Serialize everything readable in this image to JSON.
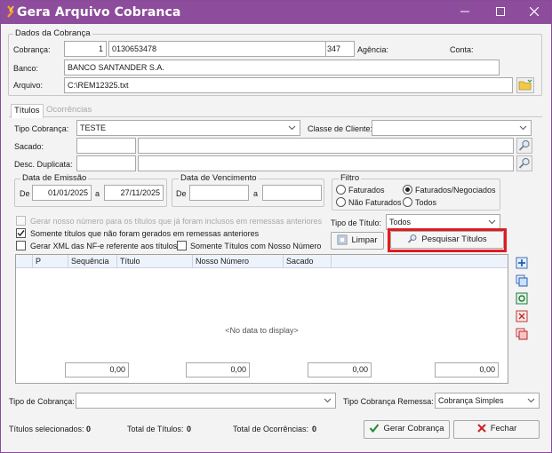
{
  "window": {
    "title": "Gera Arquivo Cobranca"
  },
  "dados": {
    "group_title": "Dados da Cobrança",
    "cobranca_label": "Cobrança:",
    "cobranca_num": "1",
    "cobranca_desc": "0130653478",
    "cobranca_code": "347",
    "agencia_label": "Agência:",
    "conta_label": "Conta:",
    "banco_label": "Banco:",
    "banco_value": "BANCO SANTANDER S.A.",
    "arquivo_label": "Arquivo:",
    "arquivo_value": "C:\\REM12325.txt"
  },
  "tabs": [
    {
      "label": "Títulos"
    },
    {
      "label": "Ocorrências"
    }
  ],
  "filters": {
    "tipo_cobranca_label": "Tipo Cobrança:",
    "tipo_cobranca_value": "TESTE",
    "classe_cliente_label": "Classe de Cliente:",
    "sacado_label": "Sacado:",
    "desc_duplicata_label": "Desc. Duplicata:"
  },
  "emissao": {
    "title": "Data de Emissão",
    "de_label": "De",
    "de_value": "01/01/2025",
    "a_label": "a",
    "a_value": "27/11/2025"
  },
  "vencimento": {
    "title": "Data de Vencimento",
    "de_label": "De",
    "a_label": "a"
  },
  "filtro": {
    "title": "Filtro",
    "faturados": "Faturados",
    "nao_faturados": "Não Faturados",
    "faturados_negociados": "Faturados/Negociados",
    "todos": "Todos"
  },
  "options": {
    "gerar_nosso_numero": "Gerar nosso número para os títulos que já foram inclusos em remessas anteriores",
    "somente_nao_gerados": "Somente títulos que não foram gerados em remessas anteriores",
    "gerar_xml": "Gerar XML das NF-e referente aos títulos",
    "somente_nosso_numero": "Somente Títulos com Nosso Número"
  },
  "tipo_titulo": {
    "label": "Tipo de Título:",
    "value": "Todos"
  },
  "buttons": {
    "limpar": "Limpar",
    "pesquisar": "Pesquisar Títulos",
    "gerar": "Gerar Cobrança",
    "fechar": "Fechar"
  },
  "grid": {
    "columns": [
      "P",
      "Sequência",
      "Título",
      "Nosso Número",
      "Sacado"
    ],
    "empty_text": "<No data to display>",
    "totals": [
      "0,00",
      "0,00",
      "0,00",
      "0,00"
    ]
  },
  "bottom": {
    "tipo_cobranca_label": "Tipo de Cobrança:",
    "tipo_remessa_label": "Tipo Cobrança Remessa:",
    "tipo_remessa_value": "Cobrança Simples"
  },
  "status": {
    "selecionados_label": "Títulos selecionados:",
    "selecionados_value": "0",
    "total_titulos_label": "Total de Títulos:",
    "total_titulos_value": "0",
    "total_ocorrencias_label": "Total de Ocorrências:",
    "total_ocorrencias_value": "0"
  },
  "colors": {
    "titlebar": "#8e4d9c",
    "highlight": "#e01b22"
  }
}
